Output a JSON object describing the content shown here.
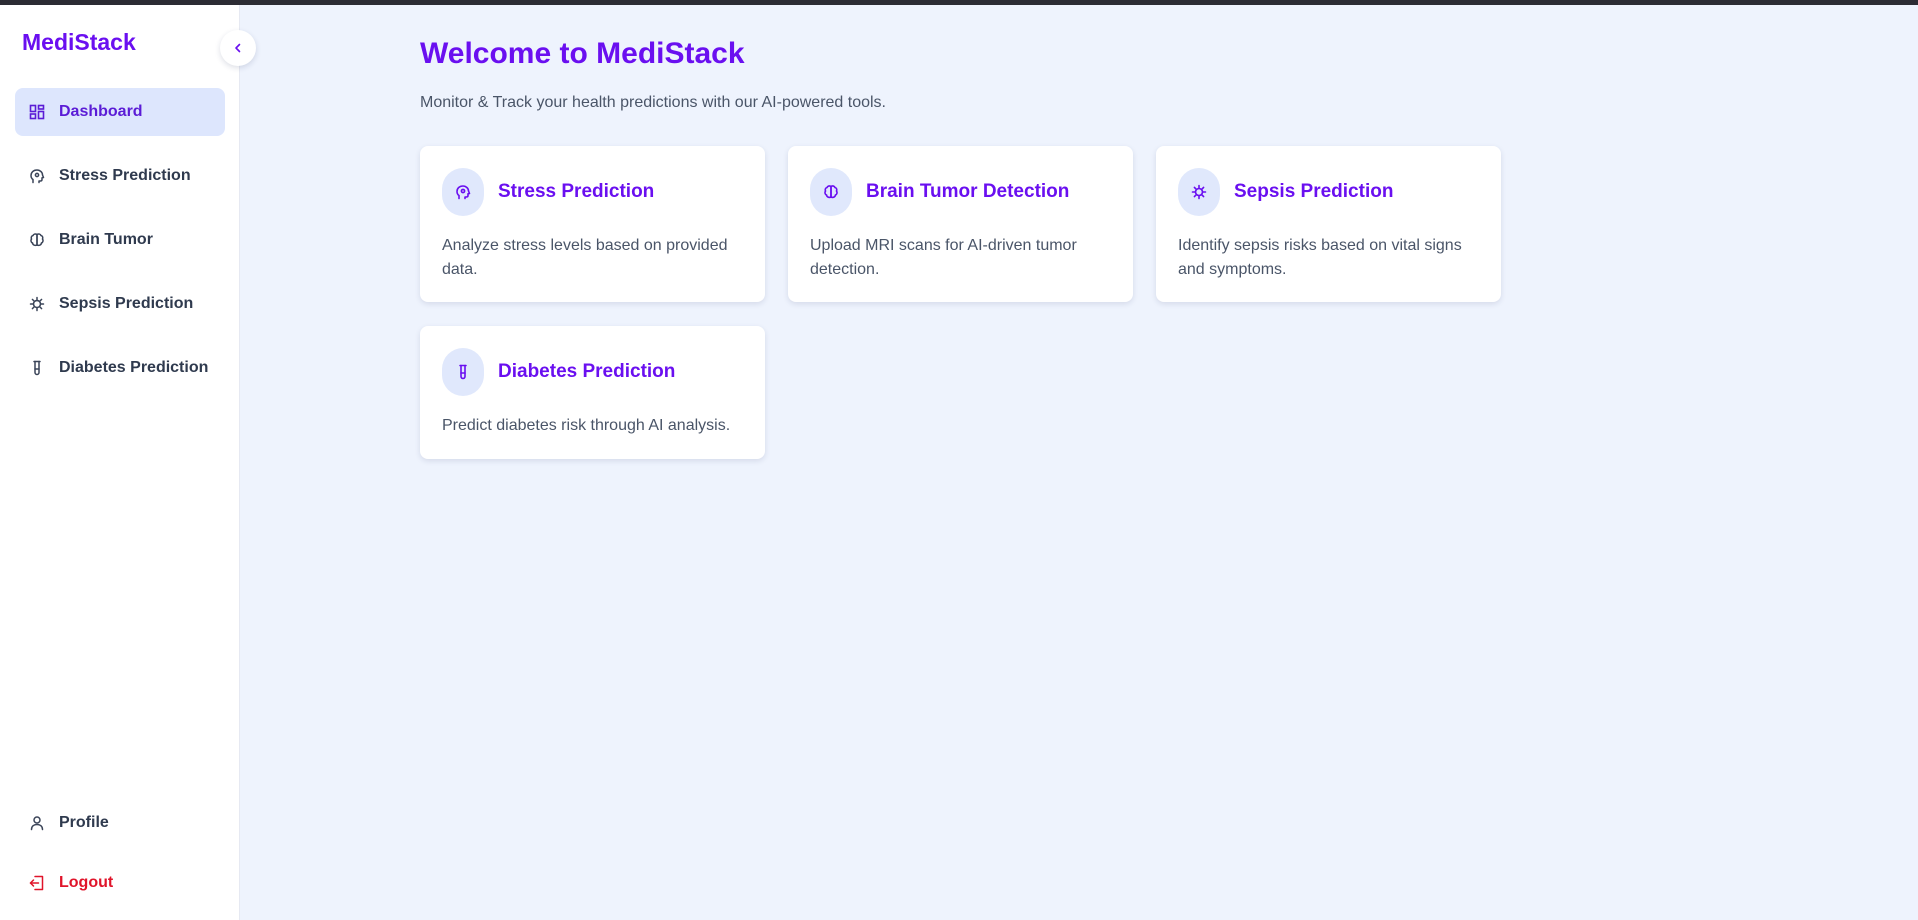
{
  "sidebar": {
    "brand": "MediStack",
    "items": [
      {
        "label": "Dashboard",
        "icon": "dashboard-icon",
        "active": true
      },
      {
        "label": "Stress Prediction",
        "icon": "head-icon"
      },
      {
        "label": "Brain Tumor",
        "icon": "brain-icon"
      },
      {
        "label": "Sepsis Prediction",
        "icon": "virus-icon"
      },
      {
        "label": "Diabetes Prediction",
        "icon": "test-tube-icon"
      }
    ],
    "bottom": [
      {
        "label": "Profile",
        "icon": "user-icon"
      },
      {
        "label": "Logout",
        "icon": "logout-icon"
      }
    ]
  },
  "main": {
    "title": "Welcome to MediStack",
    "subtitle": "Monitor & Track your health predictions with our AI-powered tools.",
    "cards": [
      {
        "title": "Stress Prediction",
        "description": "Analyze stress levels based on provided data.",
        "icon": "head-icon"
      },
      {
        "title": "Brain Tumor Detection",
        "description": "Upload MRI scans for AI-driven tumor detection.",
        "icon": "brain-icon"
      },
      {
        "title": "Sepsis Prediction",
        "description": "Identify sepsis risks based on vital signs and symptoms.",
        "icon": "virus-icon"
      },
      {
        "title": "Diabetes Prediction",
        "description": "Predict diabetes risk through AI analysis.",
        "icon": "test-tube-icon"
      }
    ]
  },
  "colors": {
    "accent": "#6a0ff0",
    "active_bg": "#dde6fd",
    "page_bg": "#eef3fd",
    "logout": "#e0142a"
  }
}
